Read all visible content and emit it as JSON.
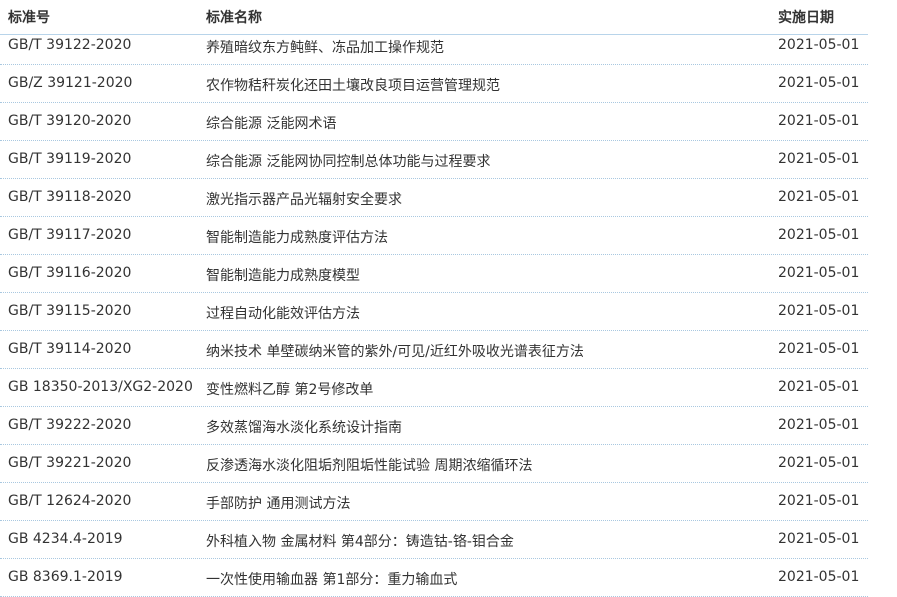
{
  "table": {
    "headers": {
      "code": "标准号",
      "name": "标准名称",
      "date": "实施日期"
    },
    "rows": [
      {
        "code": "GB/T 39122-2020",
        "name": "养殖暗纹东方鲀鲜、冻品加工操作规范",
        "date": "2021-05-01"
      },
      {
        "code": "GB/Z 39121-2020",
        "name": "农作物秸秆炭化还田土壤改良项目运营管理规范",
        "date": "2021-05-01"
      },
      {
        "code": "GB/T 39120-2020",
        "name": "综合能源 泛能网术语",
        "date": "2021-05-01"
      },
      {
        "code": "GB/T 39119-2020",
        "name": "综合能源 泛能网协同控制总体功能与过程要求",
        "date": "2021-05-01"
      },
      {
        "code": "GB/T 39118-2020",
        "name": "激光指示器产品光辐射安全要求",
        "date": "2021-05-01"
      },
      {
        "code": "GB/T 39117-2020",
        "name": "智能制造能力成熟度评估方法",
        "date": "2021-05-01"
      },
      {
        "code": "GB/T 39116-2020",
        "name": "智能制造能力成熟度模型",
        "date": "2021-05-01"
      },
      {
        "code": "GB/T 39115-2020",
        "name": "过程自动化能效评估方法",
        "date": "2021-05-01"
      },
      {
        "code": "GB/T 39114-2020",
        "name": "纳米技术 单壁碳纳米管的紫外/可见/近红外吸收光谱表征方法",
        "date": "2021-05-01"
      },
      {
        "code": "GB 18350-2013/XG2-2020",
        "name": "变性燃料乙醇 第2号修改单",
        "date": "2021-05-01"
      },
      {
        "code": "GB/T 39222-2020",
        "name": "多效蒸馏海水淡化系统设计指南",
        "date": "2021-05-01"
      },
      {
        "code": "GB/T 39221-2020",
        "name": "反渗透海水淡化阻垢剂阻垢性能试验 周期浓缩循环法",
        "date": "2021-05-01"
      },
      {
        "code": "GB/T 12624-2020",
        "name": "手部防护 通用测试方法",
        "date": "2021-05-01"
      },
      {
        "code": "GB 4234.4-2019",
        "name": "外科植入物 金属材料 第4部分：铸造钴-铬-钼合金",
        "date": "2021-05-01"
      },
      {
        "code": "GB 8369.1-2019",
        "name": "一次性使用输血器 第1部分：重力输血式",
        "date": "2021-05-01"
      }
    ]
  }
}
